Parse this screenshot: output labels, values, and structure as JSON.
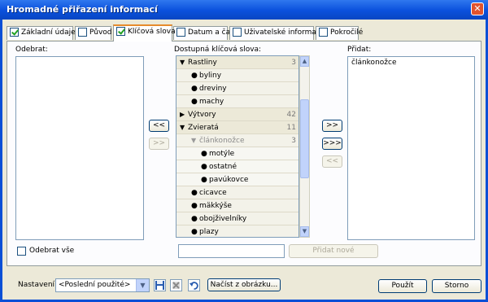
{
  "window": {
    "title": "Hromadné přiřazení informací"
  },
  "tabs": [
    {
      "label": "Základní údaje",
      "checked": true,
      "active": false
    },
    {
      "label": "Původ",
      "checked": false,
      "active": false
    },
    {
      "label": "Klíčová slova",
      "checked": true,
      "active": true
    },
    {
      "label": "Datum a čas",
      "checked": false,
      "active": false
    },
    {
      "label": "Uživatelské informace",
      "checked": false,
      "active": false
    },
    {
      "label": "Pokročilé",
      "checked": false,
      "active": false
    }
  ],
  "remove_panel": {
    "label": "Odebrat:",
    "remove_all_label": "Odebrat vše"
  },
  "available_panel": {
    "label": "Dostupná klíčová slova:",
    "tree": [
      {
        "label": "Rastliny",
        "count": "3",
        "expanded": true,
        "level": 0
      },
      {
        "label": "byliny",
        "level": 1
      },
      {
        "label": "dreviny",
        "level": 1
      },
      {
        "label": "machy",
        "level": 1
      },
      {
        "label": "Výtvory",
        "count": "42",
        "expanded": false,
        "level": 0
      },
      {
        "label": "Zvieratá",
        "count": "11",
        "expanded": true,
        "level": 0
      },
      {
        "label": "článkonožce",
        "count": "3",
        "expanded": true,
        "level": 1,
        "dimmed": true
      },
      {
        "label": "motýle",
        "level": 2
      },
      {
        "label": "ostatné",
        "level": 2
      },
      {
        "label": "pavúkovce",
        "level": 2
      },
      {
        "label": "cicavce",
        "level": 1
      },
      {
        "label": "mäkkýše",
        "level": 1
      },
      {
        "label": "obojživelníky",
        "level": 1
      },
      {
        "label": "plazy",
        "level": 1
      }
    ],
    "new_keyword_value": "",
    "add_new_label": "Přidat nové"
  },
  "move_buttons": {
    "remove_one": "<<",
    "add_one": ">>",
    "add_all": ">>>",
    "add_to_right": ">>",
    "remove_from_right": "<<"
  },
  "add_panel": {
    "label": "Přidat:",
    "items": [
      "článkonožce"
    ]
  },
  "footer": {
    "settings_label": "Nastavení:",
    "settings_value": "<Poslední použité>",
    "load_from_image_label": "Načíst z obrázku...",
    "apply_label": "Použít",
    "cancel_label": "Storno"
  },
  "colors": {
    "titlebar": "#0a50dc",
    "face": "#ece9d8",
    "tab_active_accent": "#e68b2c"
  }
}
